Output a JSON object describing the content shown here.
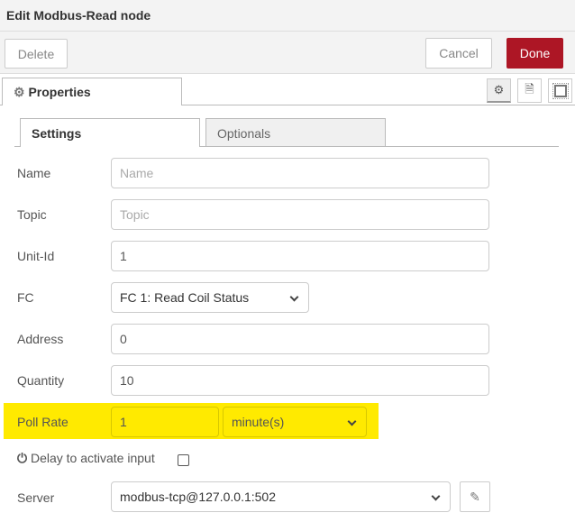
{
  "title": "Edit Modbus-Read node",
  "toolbar": {
    "delete": "Delete",
    "cancel": "Cancel",
    "done": "Done",
    "done_color": "#ad1625"
  },
  "tabs": {
    "properties": "Properties"
  },
  "subtabs": {
    "settings": "Settings",
    "optionals": "Optionals"
  },
  "form": {
    "name": {
      "label": "Name",
      "placeholder": "Name"
    },
    "topic": {
      "label": "Topic",
      "placeholder": "Topic"
    },
    "unit_id": {
      "label": "Unit-Id",
      "value": "1"
    },
    "fc": {
      "label": "FC",
      "value": "FC 1: Read Coil Status"
    },
    "address": {
      "label": "Address",
      "value": "0"
    },
    "quantity": {
      "label": "Quantity",
      "value": "10"
    },
    "poll_rate": {
      "label": "Poll Rate",
      "value": "1",
      "unit": "minute(s)",
      "highlight_color": "#ffea00"
    },
    "delay": {
      "label": "Delay to activate input",
      "checked": false
    },
    "server": {
      "label": "Server",
      "value": "modbus-tcp@127.0.0.1:502"
    }
  }
}
